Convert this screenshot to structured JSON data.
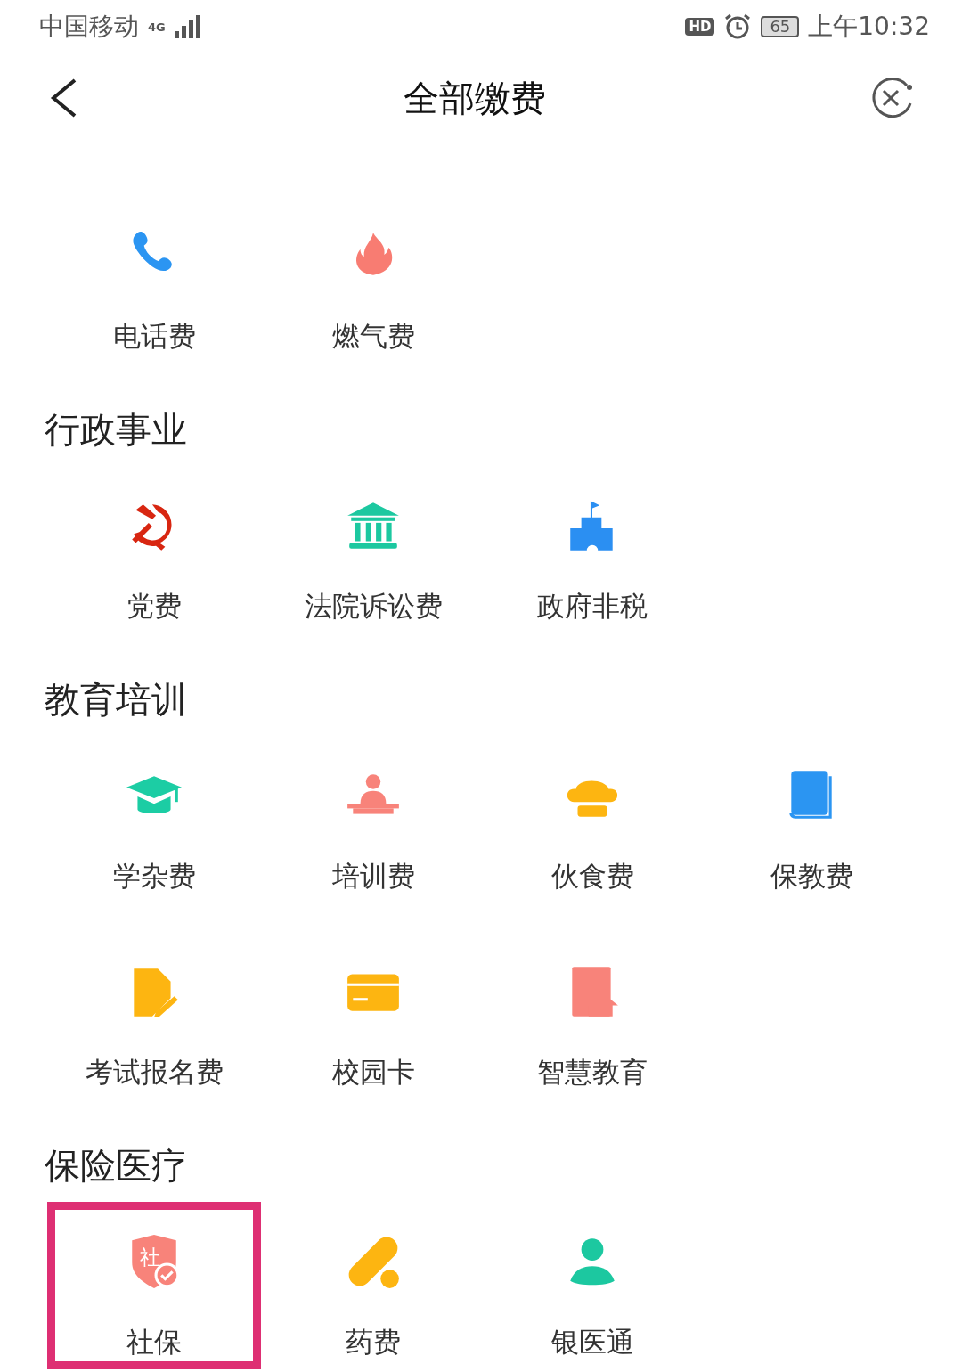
{
  "status_bar": {
    "carrier": "中国移动",
    "network": "4G",
    "hd": "HD",
    "battery": "65",
    "time": "上午10:32"
  },
  "nav": {
    "title": "全部缴费"
  },
  "sections": [
    {
      "items": [
        {
          "label": "电话费",
          "selected": false
        },
        {
          "label": "燃气费",
          "selected": false
        }
      ]
    },
    {
      "heading": "行政事业",
      "items": [
        {
          "label": "党费",
          "selected": false
        },
        {
          "label": "法院诉讼费",
          "selected": false
        },
        {
          "label": "政府非税",
          "selected": false
        }
      ]
    },
    {
      "heading": "教育培训",
      "items": [
        {
          "label": "学杂费",
          "selected": false
        },
        {
          "label": "培训费",
          "selected": false
        },
        {
          "label": "伙食费",
          "selected": false
        },
        {
          "label": "保教费",
          "selected": false
        },
        {
          "label": "考试报名费",
          "selected": false
        },
        {
          "label": "校园卡",
          "selected": false
        },
        {
          "label": "智慧教育",
          "selected": false
        }
      ]
    },
    {
      "heading": "保险医疗",
      "items": [
        {
          "label": "社保",
          "badge": "社",
          "selected": true
        },
        {
          "label": "药费",
          "selected": false
        },
        {
          "label": "银医通",
          "selected": false
        }
      ]
    }
  ]
}
